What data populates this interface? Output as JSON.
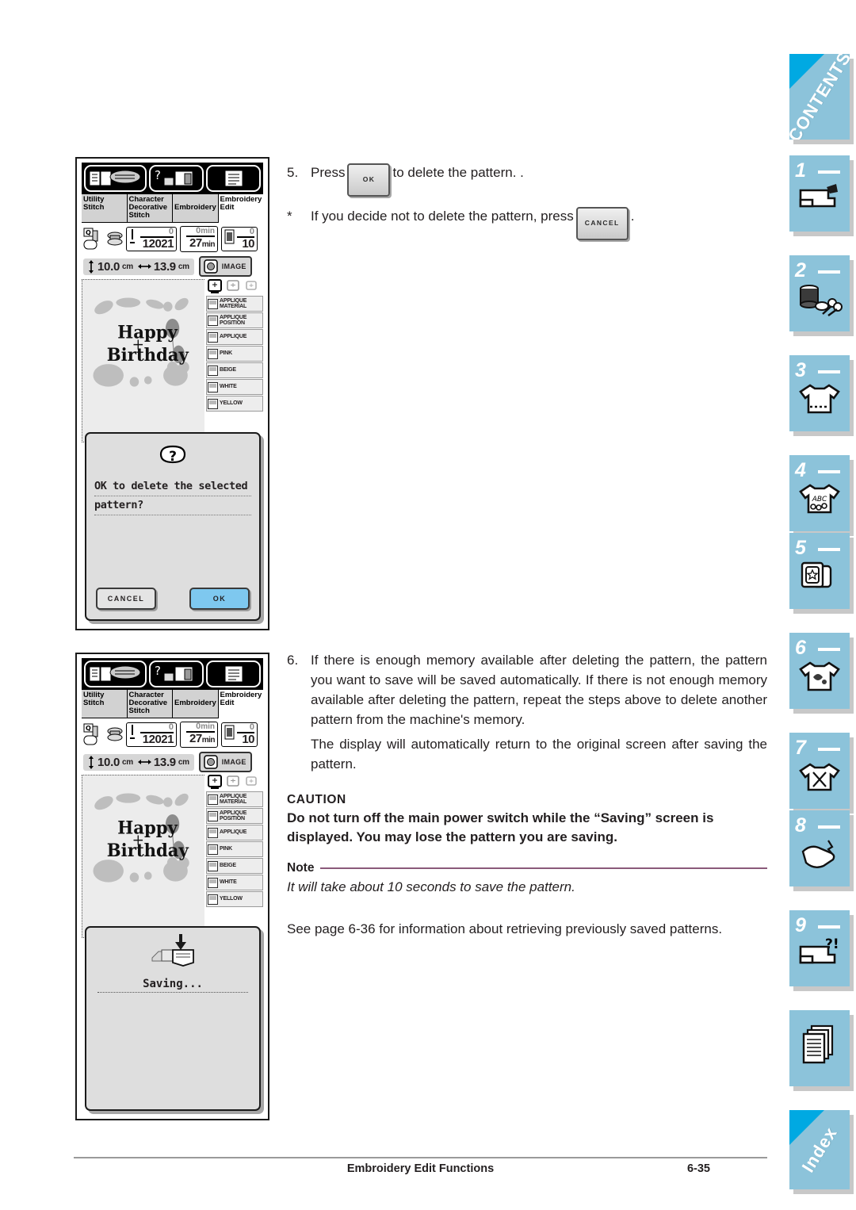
{
  "footer": {
    "title": "Embroidery Edit Functions",
    "page": "6-35"
  },
  "rail": {
    "contents_label": "CONTENTS",
    "index_label": "Index",
    "numbers": [
      "1",
      "2",
      "3",
      "4",
      "5",
      "6",
      "7",
      "8",
      "9"
    ],
    "accent_corner": "#00a9e2",
    "tab_color": "#8cc3da"
  },
  "instructions": {
    "step5": {
      "number": "5.",
      "before": "Press",
      "button": "OK",
      "after": "to delete the pattern. ."
    },
    "note_star": {
      "number": "*",
      "before": "If you decide not to delete the pattern, press",
      "button": "CANCEL",
      "after": "."
    },
    "step6": {
      "number": "6.",
      "body": "If there is enough memory available after deleting the pattern, the pattern you want to save will be saved automatically. If there is not enough memory available after deleting the pattern, repeat the steps above to delete another pattern from the machine's memory.",
      "body2": "The display will automatically return to the original screen after saving the pattern."
    },
    "caution": {
      "heading": "CAUTION",
      "body": "Do not turn off the main power switch while the “Saving” screen is displayed. You may lose the pattern you are saving."
    },
    "note": {
      "heading": "Note",
      "body": "It will take about 10 seconds to save the pattern.",
      "rule_color": "#8a5a7a"
    },
    "see_also": "See page 6-36 for information about retrieving previously saved patterns."
  },
  "lcd": {
    "tabs": [
      {
        "line1": "Utility",
        "line2": "Stitch",
        "line3": "",
        "active": false
      },
      {
        "line1": "Character",
        "line2": "Decorative",
        "line3": "Stitch",
        "active": false
      },
      {
        "line1": "Embroidery",
        "line2": "",
        "line3": "",
        "active": false
      },
      {
        "line1": "Embroidery",
        "line2": "Edit",
        "line3": "",
        "active": true
      }
    ],
    "counters": [
      {
        "top": "0",
        "bottom": "12021",
        "unit": "",
        "top_unit": "",
        "icon": "needle-icon"
      },
      {
        "top": "0",
        "top_unit": "min",
        "bottom": "27",
        "unit": "min",
        "icon": "time-icon"
      },
      {
        "top": "0",
        "bottom": "10",
        "unit": "",
        "top_unit": "",
        "icon": "thread-spool-icon"
      }
    ],
    "size": {
      "height": "10.0",
      "width": "13.9",
      "unit": "cm"
    },
    "image_button": "IMAGE",
    "pattern_text": {
      "line1": "Happy",
      "line2": "Birthday"
    },
    "colors": [
      {
        "line1": "APPLIQUE",
        "line2": "MATERIAL"
      },
      {
        "line1": "APPLIQUE",
        "line2": "POSITION"
      },
      {
        "line1": "APPLIQUE",
        "line2": ""
      },
      {
        "line1": "PINK",
        "line2": ""
      },
      {
        "line1": "BEIGE",
        "line2": ""
      },
      {
        "line1": "WHITE",
        "line2": ""
      },
      {
        "line1": "YELLOW",
        "line2": ""
      }
    ]
  },
  "dialog_delete": {
    "icon": "question-mark-icon",
    "message_line1": "OK to delete the selected",
    "message_line2": "pattern?",
    "cancel_label": "CANCEL",
    "ok_label": "OK",
    "ok_color": "#7ec8ef"
  },
  "dialog_saving": {
    "icon": "save-down-arrow-icon",
    "message": "Saving..."
  }
}
